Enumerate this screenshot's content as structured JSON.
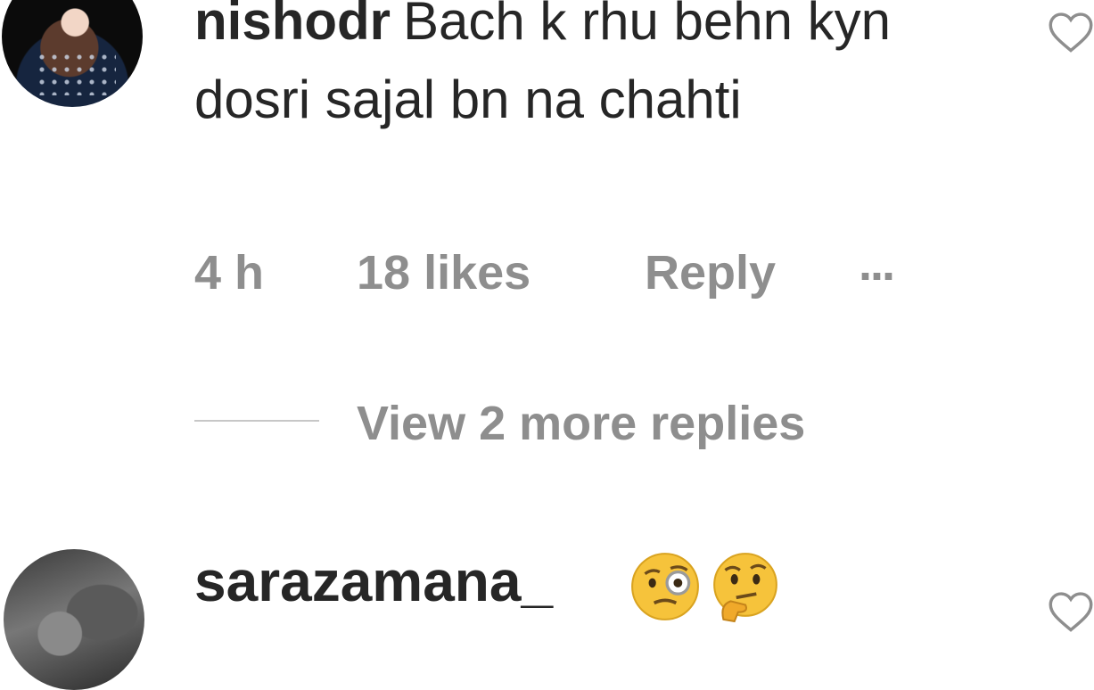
{
  "comments": [
    {
      "username": "nishodr",
      "text": "Bach k rhu behn kyn dosri sajal bn na chahti",
      "time": "4 h",
      "likes": "18 likes",
      "reply_label": "Reply",
      "more_label": "...",
      "view_replies": "View 2 more replies",
      "avatar_icon": "profile-photo-avatar",
      "like_icon": "heart-outline-icon"
    },
    {
      "username": "sarazamana_",
      "emojis": [
        "face-with-monocle-emoji",
        "thinking-face-emoji"
      ],
      "avatar_icon": "profile-photo-avatar",
      "like_icon": "heart-outline-icon"
    }
  ],
  "colors": {
    "text": "#262626",
    "meta": "#8e8e8e",
    "divider": "#c7c7c7",
    "emoji_yellow": "#f6c33b"
  }
}
